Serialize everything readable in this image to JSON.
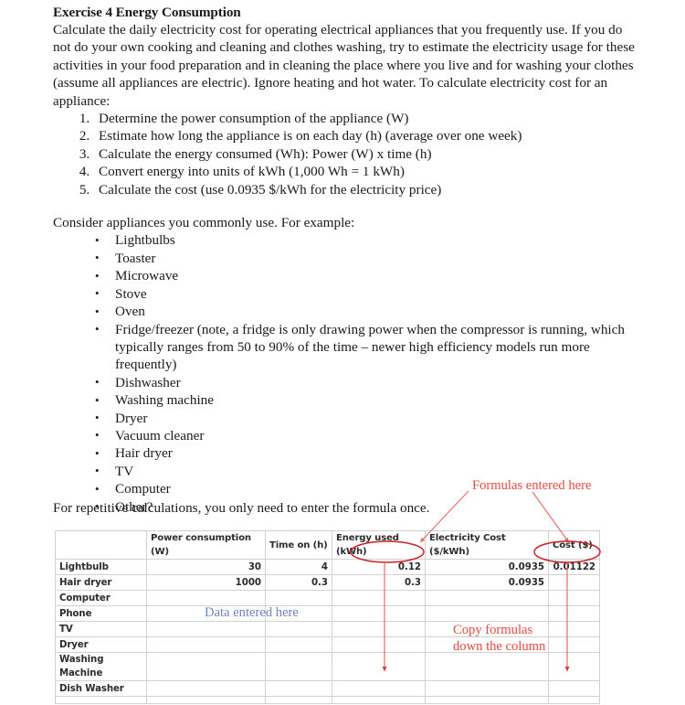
{
  "document": {
    "title": "Exercise 4 Energy Consumption",
    "intro": "Calculate the daily electricity cost for operating electrical appliances that you frequently use. If you do not do your own cooking and cleaning and clothes washing, try to estimate the electricity usage for these activities in your food preparation and in cleaning the place where you live and for washing your clothes (assume all appliances are electric). Ignore heating and hot water. To calculate electricity cost for an appliance:",
    "steps": [
      "Determine the power consumption of the appliance (W)",
      "Estimate how long the appliance is on each day (h) (average over one week)",
      "Calculate the energy consumed (Wh): Power (W) x time (h)",
      "Convert energy into units of kWh (1,000 Wh = 1 kWh)",
      "Calculate the cost (use 0.0935 $/kWh for the electricity price)"
    ],
    "consider_intro": "Consider appliances you commonly use. For example:",
    "appliances": [
      "Lightbulbs",
      "Toaster",
      "Microwave",
      "Stove",
      "Oven",
      "Fridge/freezer (note, a fridge is only drawing power when the compressor is running, which typically ranges from 50 to 90% of the time – newer high efficiency models run more frequently)",
      "Dishwasher",
      "Washing machine",
      "Dryer",
      "Vacuum cleaner",
      "Hair dryer",
      "TV",
      "Computer",
      "Other?"
    ],
    "repetitive_note": "For repetitive calculations, you only need to enter the formula once."
  },
  "annotations": {
    "formulas_entered_here": "Formulas entered here",
    "data_entered_here": "Data entered here",
    "copy_formulas_line1": "Copy formulas",
    "copy_formulas_line2": "down the column",
    "formulas_color": "#e8493f",
    "data_color": "#6a84c4",
    "circle_color": "#cc2026",
    "arrow_color": "#ef6a61"
  },
  "spreadsheet": {
    "columns": [
      "",
      "Power consumption (W)",
      "Time on (h)",
      "Energy used (kWh)",
      "Electricity Cost ($/kWh)",
      "Cost ($)"
    ],
    "rows": [
      {
        "label": "Lightbulb",
        "power": "30",
        "time": "4",
        "energy": "0.12",
        "elec": "0.0935",
        "cost": "0.01122"
      },
      {
        "label": "Hair dryer",
        "power": "1000",
        "time": "0.3",
        "energy": "0.3",
        "elec": "0.0935",
        "cost": ""
      },
      {
        "label": "Computer",
        "power": "",
        "time": "",
        "energy": "",
        "elec": "",
        "cost": ""
      },
      {
        "label": "Phone",
        "power": "",
        "time": "",
        "energy": "",
        "elec": "",
        "cost": ""
      },
      {
        "label": "TV",
        "power": "",
        "time": "",
        "energy": "",
        "elec": "",
        "cost": ""
      },
      {
        "label": "Dryer",
        "power": "",
        "time": "",
        "energy": "",
        "elec": "",
        "cost": ""
      },
      {
        "label": "Washing Machine",
        "power": "",
        "time": "",
        "energy": "",
        "elec": "",
        "cost": ""
      },
      {
        "label": "Dish Washer",
        "power": "",
        "time": "",
        "energy": "",
        "elec": "",
        "cost": ""
      }
    ]
  }
}
